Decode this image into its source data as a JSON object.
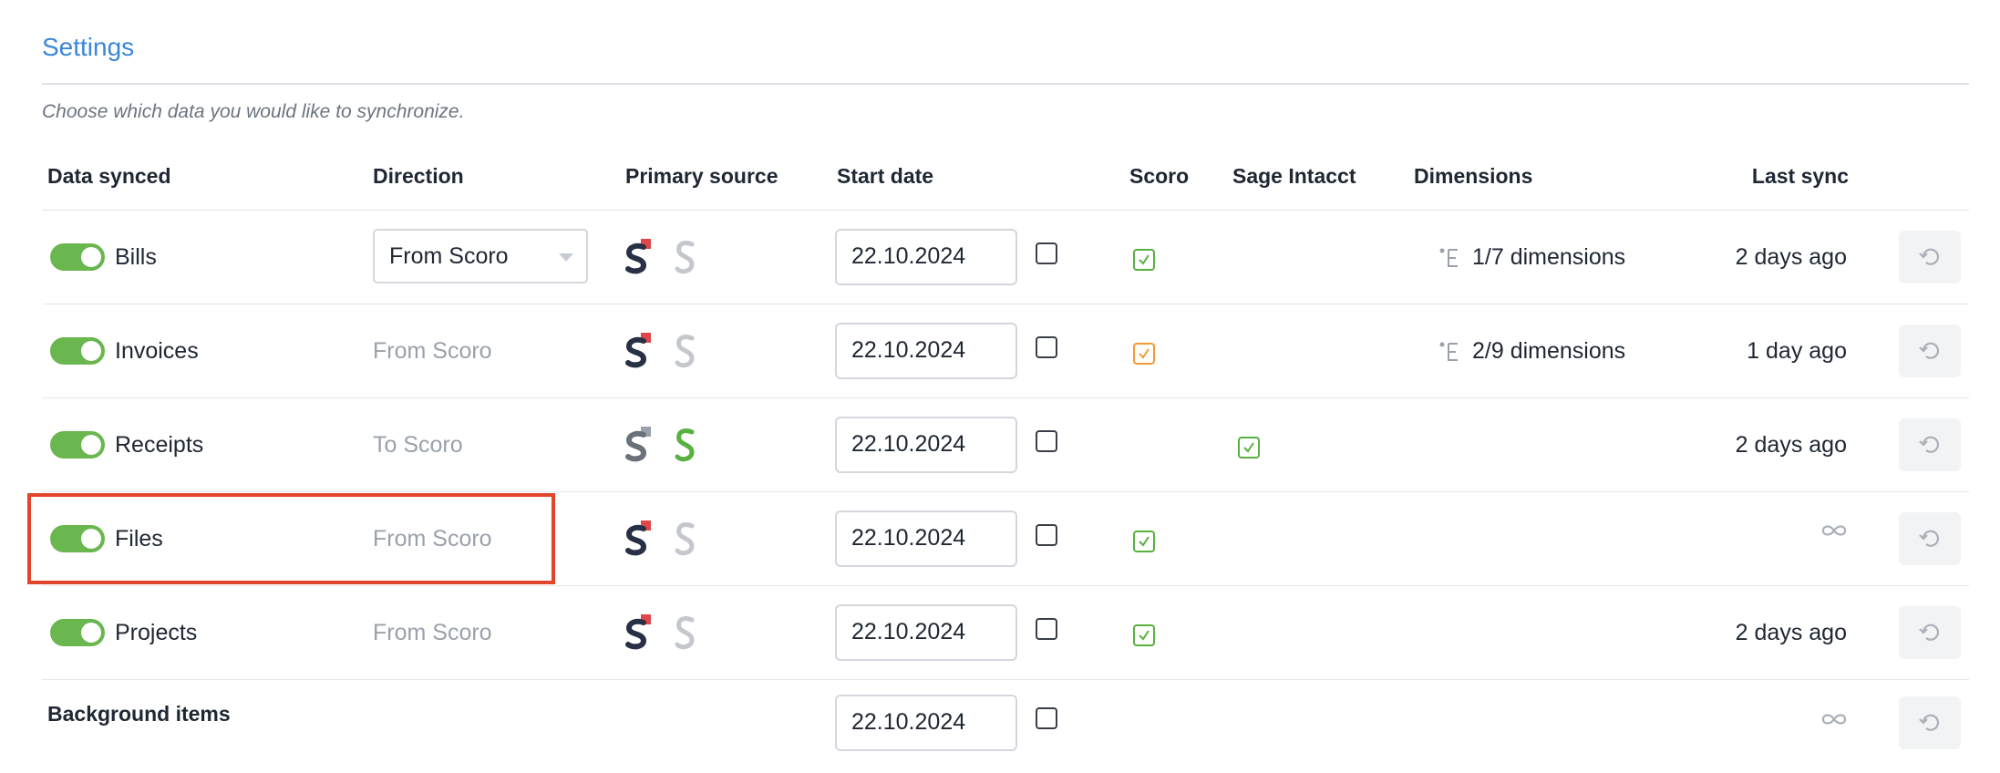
{
  "title": "Settings",
  "subtitle": "Choose which data you would like to synchronize.",
  "columns": {
    "data_synced": "Data synced",
    "direction": "Direction",
    "primary_source": "Primary source",
    "start_date": "Start date",
    "scoro": "Scoro",
    "sage_intacct": "Sage Intacct",
    "dimensions": "Dimensions",
    "last_sync": "Last sync"
  },
  "rows": [
    {
      "label": "Bills",
      "enabled": true,
      "direction": "From Scoro",
      "direction_editable": true,
      "primary_source": "scoro",
      "start_date": "22.10.2024",
      "checked": false,
      "scoro_checked": true,
      "scoro_check_color": "#58b13f",
      "sage_checked": false,
      "dimensions": "1/7 dimensions",
      "last_sync": "2 days ago"
    },
    {
      "label": "Invoices",
      "enabled": true,
      "direction": "From Scoro",
      "direction_editable": false,
      "primary_source": "scoro",
      "start_date": "22.10.2024",
      "checked": false,
      "scoro_checked": true,
      "scoro_check_color": "#f29a35",
      "sage_checked": false,
      "dimensions": "2/9 dimensions",
      "last_sync": "1 day ago"
    },
    {
      "label": "Receipts",
      "enabled": true,
      "direction": "To Scoro",
      "direction_editable": false,
      "primary_source": "sage",
      "start_date": "22.10.2024",
      "checked": false,
      "scoro_checked": false,
      "sage_checked": true,
      "dimensions": "",
      "last_sync": "2 days ago"
    },
    {
      "label": "Files",
      "enabled": true,
      "direction": "From Scoro",
      "direction_editable": false,
      "primary_source": "scoro",
      "start_date": "22.10.2024",
      "checked": false,
      "scoro_checked": true,
      "scoro_check_color": "#58b13f",
      "sage_checked": false,
      "dimensions": "",
      "last_sync_icon": "infinity-icon"
    },
    {
      "label": "Projects",
      "enabled": true,
      "direction": "From Scoro",
      "direction_editable": false,
      "primary_source": "scoro",
      "start_date": "22.10.2024",
      "checked": false,
      "scoro_checked": true,
      "scoro_check_color": "#58b13f",
      "sage_checked": false,
      "dimensions": "",
      "last_sync": "2 days ago"
    }
  ],
  "background": {
    "label": "Background items",
    "start_date": "22.10.2024",
    "checked": false,
    "last_sync_icon": "infinity-icon"
  },
  "icons": {
    "scoro_logo": "scoro-logo-icon",
    "sage_logo": "sage-s-icon",
    "dimension": "dimension-icon",
    "resync": "resync-icon",
    "infinity": "infinity-icon",
    "check": "check-icon"
  },
  "colors": {
    "title": "#3b86d6",
    "toggle_on": "#6ab64f",
    "sage_active": "#58b13f",
    "sage_inactive": "#c4c8cd",
    "scoro_dark": "#283046",
    "scoro_red": "#e0464a",
    "highlight": "#e2442c"
  }
}
